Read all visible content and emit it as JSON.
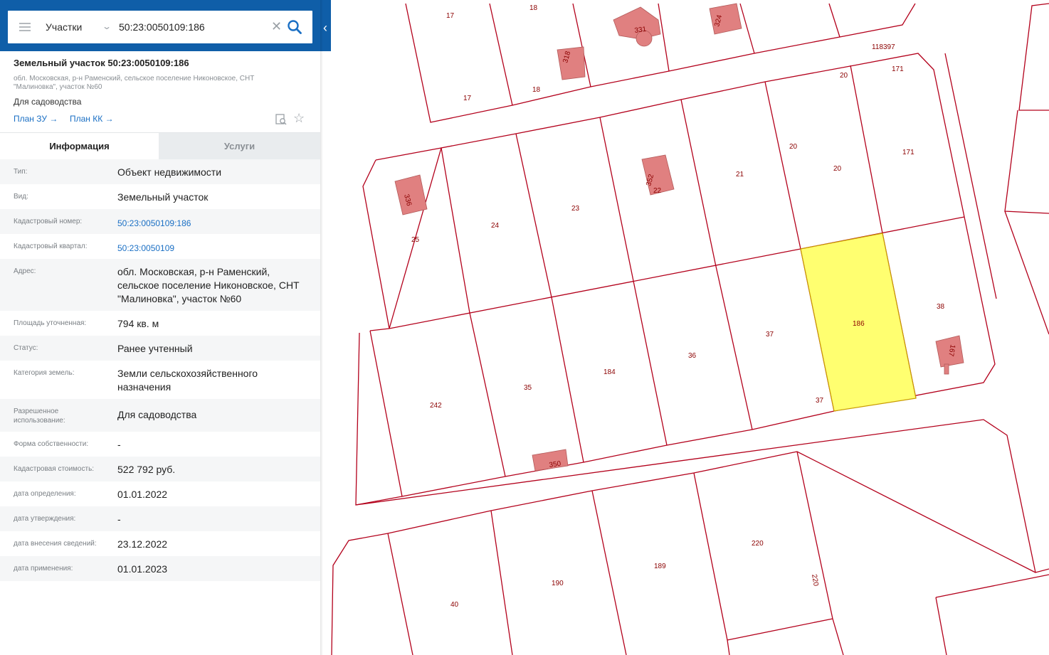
{
  "search": {
    "layer": "Участки",
    "query": "50:23:0050109:186"
  },
  "object": {
    "title": "Земельный участок 50:23:0050109:186",
    "address": "обл. Московская, р-н Раменский, сельское поселение Никоновское, СНТ \"Малиновка\", участок №60",
    "purpose": "Для садоводства",
    "links": {
      "plan_zu": "План ЗУ →",
      "plan_kk": "План КК →"
    }
  },
  "tabs": {
    "info": "Информация",
    "services": "Услуги"
  },
  "fields": [
    {
      "key": "Тип:",
      "value": "Объект недвижимости"
    },
    {
      "key": "Вид:",
      "value": "Земельный участок"
    },
    {
      "key": "Кадастровый номер:",
      "value": "50:23:0050109:186",
      "link": true
    },
    {
      "key": "Кадастровый квартал:",
      "value": "50:23:0050109",
      "link": true
    },
    {
      "key": "Адрес:",
      "value": "обл. Московская, р-н Раменский, сельское поселение Никоновское, СНТ \"Малиновка\", участок №60"
    },
    {
      "key": "Площадь уточненная:",
      "value": "794 кв. м"
    },
    {
      "key": "Статус:",
      "value": "Ранее учтенный"
    },
    {
      "key": "Категория земель:",
      "value": "Земли сельскохозяйственного назначения"
    },
    {
      "key": "Разрешенное использование:",
      "value": "Для садоводства"
    },
    {
      "key": "Форма собственности:",
      "value": "-"
    },
    {
      "key": "Кадастровая стоимость:",
      "value": "522 792 руб."
    },
    {
      "key": "дата определения:",
      "value": "01.01.2022"
    },
    {
      "key": "дата утверждения:",
      "value": "-"
    },
    {
      "key": "дата внесения сведений:",
      "value": "23.12.2022"
    },
    {
      "key": "дата применения:",
      "value": "01.01.2023"
    }
  ],
  "map": {
    "colors": {
      "boundary": "#b3001b",
      "building": "#e08080",
      "selected": "#ffff70",
      "label": "#8b0000"
    },
    "parcel_labels": [
      "17",
      "18",
      "17",
      "18",
      "118397",
      "20",
      "171",
      "331",
      "318",
      "324",
      "336",
      "25",
      "24",
      "23",
      "352",
      "22",
      "21",
      "20",
      "20",
      "171",
      "38",
      "186",
      "37",
      "37",
      "36",
      "184",
      "35",
      "242",
      "350",
      "220",
      "220",
      "189",
      "190",
      "40",
      "167"
    ]
  }
}
